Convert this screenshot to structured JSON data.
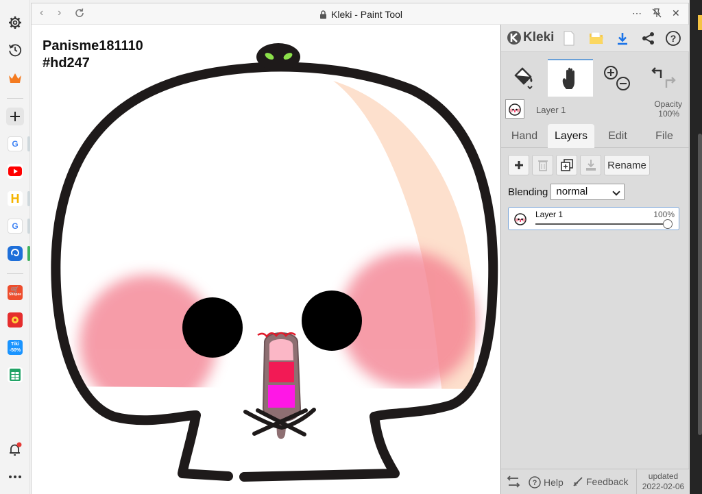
{
  "window": {
    "title": "Kleki - Paint Tool"
  },
  "canvas_text": {
    "line1": "Panisme181110",
    "line2": "#hd247"
  },
  "app": {
    "logo": "Kleki"
  },
  "layer_header": {
    "name": "Layer 1",
    "opacity_label": "Opacity",
    "opacity_value": "100%"
  },
  "tabs": [
    "Hand",
    "Layers",
    "Edit",
    "File"
  ],
  "layers_panel": {
    "rename_label": "Rename",
    "blending_label": "Blending",
    "blending_value": "normal",
    "layers": [
      {
        "name": "Layer 1",
        "opacity": "100%",
        "opacity_fraction": 1.0
      }
    ]
  },
  "footer": {
    "help_label": "Help",
    "feedback_label": "Feedback",
    "updated_label": "updated",
    "updated_date": "2022-02-06"
  },
  "sidebar_icons": [
    "gear-icon",
    "history-icon",
    "crown-icon",
    "plus-icon",
    "google-icon",
    "youtube-icon",
    "h-icon",
    "google-icon",
    "edge-icon",
    "shopee-icon",
    "game-icon",
    "tiki-icon",
    "sheets-icon",
    "bell-icon",
    "more-icon"
  ],
  "sidebar_text": {
    "shopee": "Shopee",
    "tiki": "Tiki",
    "tiki_sale": "-50%"
  },
  "colors": {
    "accent": "#1a73e8",
    "blush": "#f37b8c",
    "peach": "#fde0cd",
    "stroke": "#1e1a1a",
    "nose_red": "#f21a55",
    "nose_magenta": "#ff17e6"
  }
}
